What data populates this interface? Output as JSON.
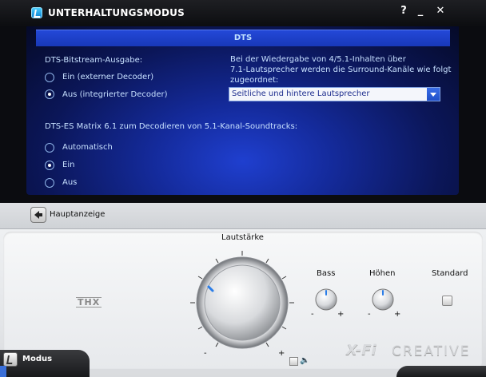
{
  "window": {
    "title": "UNTERHALTUNGSMODUS",
    "help": "?",
    "minimize": "_",
    "close": "✕"
  },
  "panel": {
    "header": "DTS",
    "bitstream_label": "DTS-Bitstream-Ausgabe:",
    "bitstream_options": [
      {
        "label": "Ein (externer Decoder)",
        "selected": false
      },
      {
        "label": "Aus (integrierter Decoder)",
        "selected": true
      }
    ],
    "desc_line1": "Bei der Wiedergabe von 4/5.1-Inhalten über",
    "desc_line2": "7.1-Lautsprecher werden die Surround-Kanäle wie folgt",
    "desc_line3": "zugeordnet:",
    "speaker_select": "Seitliche und hintere Lautsprecher",
    "matrix_label": "DTS-ES Matrix 6.1 zum Decodieren von 5.1-Kanal-Soundtracks:",
    "matrix_options": [
      {
        "label": "Automatisch",
        "selected": false
      },
      {
        "label": "Ein",
        "selected": true
      },
      {
        "label": "Aus",
        "selected": false
      }
    ]
  },
  "nav": {
    "back_label": "Hauptanzeige"
  },
  "controls": {
    "volume_label": "Lautstärke",
    "bass_label": "Bass",
    "treble_label": "Höhen",
    "standard_label": "Standard",
    "thx": "THX",
    "knob_minus": "-",
    "knob_plus": "+"
  },
  "footer": {
    "mode_label": "Modus",
    "xfi": "X-Fi",
    "brand": "CREATIVE"
  },
  "colors": {
    "panel_blue": "#142a9a",
    "header_blue": "#2348d8",
    "text_blue": "#c7e0ff"
  }
}
